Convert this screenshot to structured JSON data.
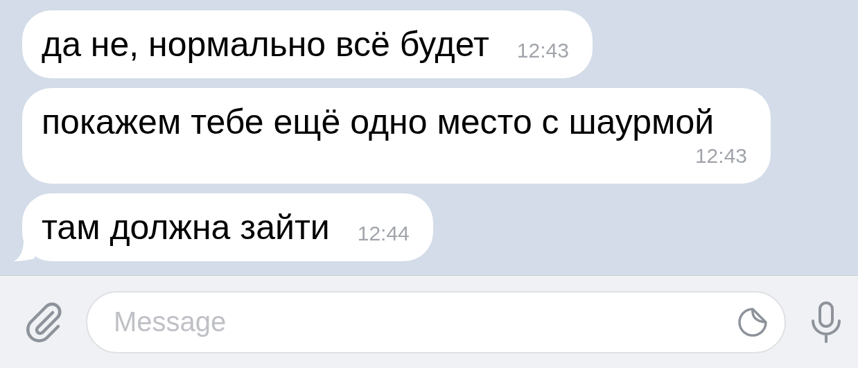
{
  "messages": [
    {
      "text": "да не, нормально всё будет",
      "time": "12:43",
      "tail": false
    },
    {
      "text": "покажем тебе ещё одно место с шаурмой",
      "time": "12:43",
      "tail": false
    },
    {
      "text": "там должна зайти",
      "time": "12:44",
      "tail": true
    }
  ],
  "composer": {
    "placeholder": "Message"
  }
}
